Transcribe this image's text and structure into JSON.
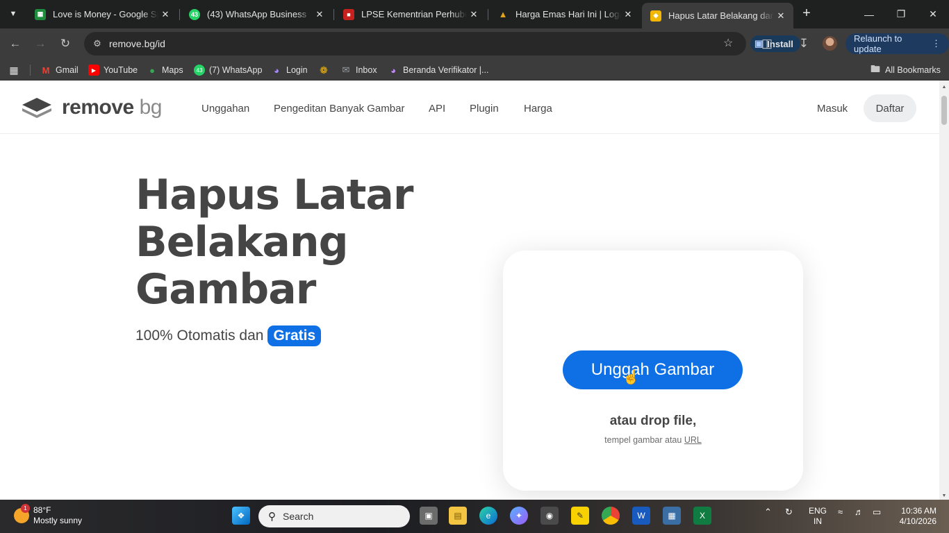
{
  "browser": {
    "tabs": [
      {
        "title": "Love is Money - Google Spre",
        "favicon": "sheets-icon",
        "color": "#1e8e3e"
      },
      {
        "title": "(43) WhatsApp Business",
        "favicon": "whatsapp-icon",
        "color": "#25d366",
        "badge": "43"
      },
      {
        "title": "LPSE Kementrian Perhubung",
        "favicon": "lpse-icon",
        "color": "#c5221f"
      },
      {
        "title": "Harga Emas Hari Ini | Logam",
        "favicon": "gold-icon",
        "color": "#e0a31a"
      },
      {
        "title": "Hapus Latar Belakang dari G",
        "favicon": "removebg-icon",
        "color": "#f2b705",
        "active": true
      }
    ],
    "url": "remove.bg/id",
    "install_label": "Install",
    "relaunch_label": "Relaunch to update",
    "bookmarks": [
      {
        "label": "Gmail",
        "icon": "gmail-icon"
      },
      {
        "label": "YouTube",
        "icon": "youtube-icon"
      },
      {
        "label": "Maps",
        "icon": "maps-icon"
      },
      {
        "label": "(7) WhatsApp",
        "icon": "whatsapp-icon",
        "badge": "43"
      },
      {
        "label": "Login",
        "icon": "globe-icon"
      },
      {
        "label": "",
        "icon": "photos-icon"
      },
      {
        "label": "Inbox",
        "icon": "mail-icon"
      },
      {
        "label": "Beranda Verifikator |...",
        "icon": "globe-icon"
      }
    ],
    "all_bookmarks_label": "All Bookmarks"
  },
  "site": {
    "logo_main": "remove",
    "logo_accent": "bg",
    "nav": [
      "Unggahan",
      "Pengeditan Banyak Gambar",
      "API",
      "Plugin",
      "Harga"
    ],
    "login_label": "Masuk",
    "signup_label": "Daftar",
    "hero_title": "Hapus Latar Belakang Gambar",
    "hero_sub_prefix": "100% Otomatis dan",
    "hero_sub_badge": "Gratis",
    "upload_button": "Unggah Gambar",
    "drop_text": "atau drop file,",
    "paste_text": "tempel gambar atau",
    "paste_link": "URL",
    "brand_color": "#0f70e6"
  },
  "taskbar": {
    "weather_temp": "88°F",
    "weather_desc": "Mostly sunny",
    "weather_badge": "1",
    "search_placeholder": "Search",
    "lang_line1": "ENG",
    "lang_line2": "IN",
    "time": "10:36 AM",
    "date": "4/10/2026"
  }
}
